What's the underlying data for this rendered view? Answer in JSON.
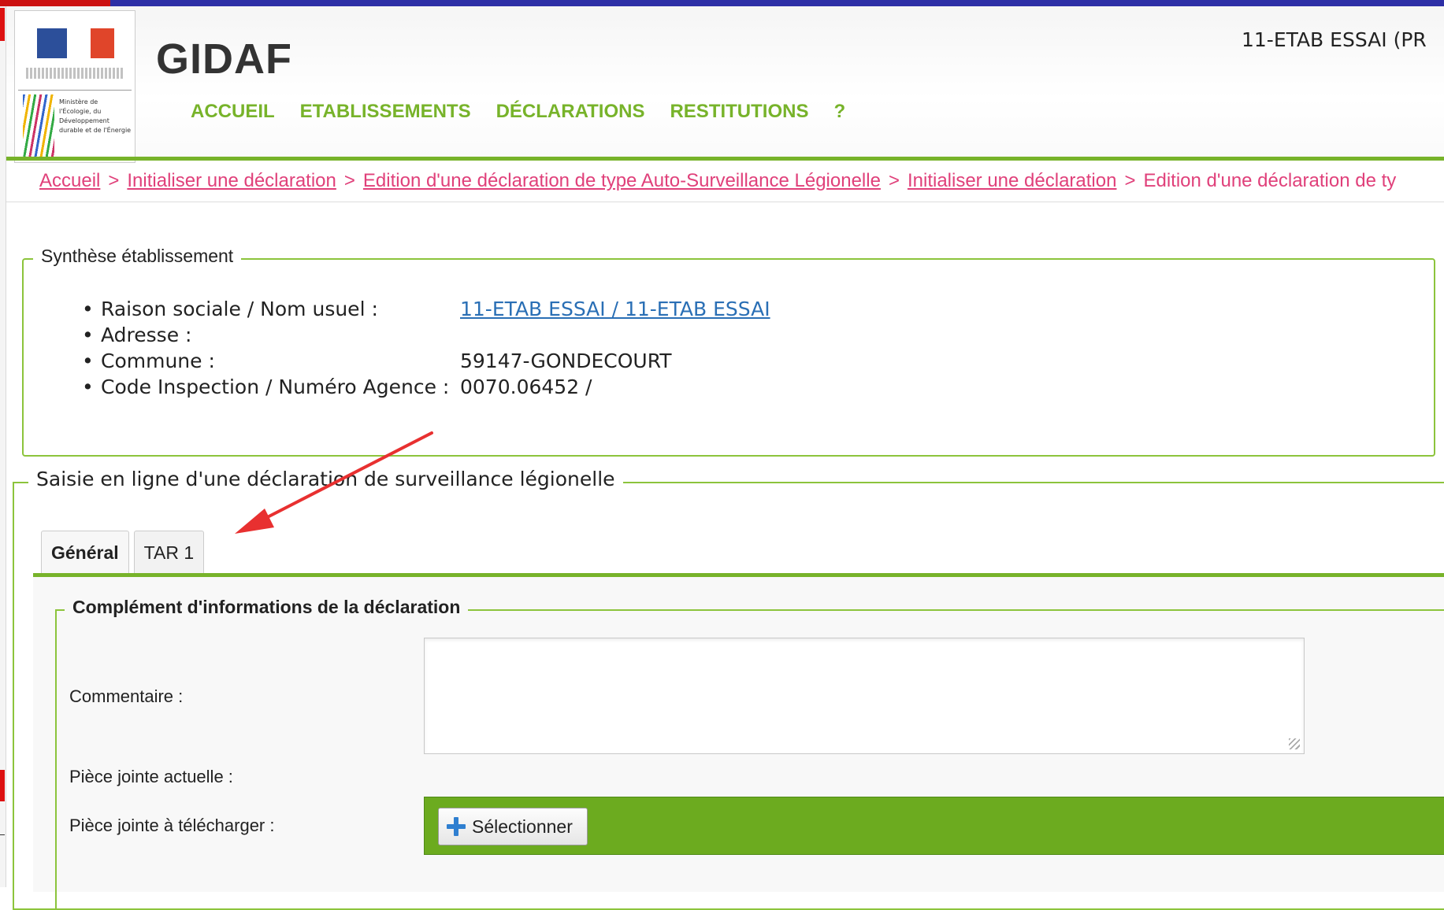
{
  "header": {
    "app_title": "GIDAF",
    "user": "11-ETAB ESSAI (PR",
    "logo_text": "Ministère de l'Écologie, du Développement durable et de l'Énergie",
    "nav": [
      "ACCUEIL",
      "ETABLISSEMENTS",
      "DÉCLARATIONS",
      "RESTITUTIONS",
      "?"
    ]
  },
  "breadcrumb": {
    "items": [
      "Accueil",
      "Initialiser une déclaration",
      "Edition d'une déclaration de type Auto-Surveillance Légionelle",
      "Initialiser une déclaration"
    ],
    "current": "Edition d'une déclaration de ty",
    "separator": ">"
  },
  "synthese": {
    "legend": "Synthèse établissement",
    "rows": [
      {
        "label": "Raison sociale / Nom usuel :",
        "value": "11-ETAB ESSAI / 11-ETAB ESSAI"
      },
      {
        "label": "Adresse :",
        "value": ""
      },
      {
        "label": "Commune :",
        "value": "59147-GONDECOURT"
      },
      {
        "label": "Code Inspection / Numéro Agence :",
        "value": "0070.06452 /"
      }
    ]
  },
  "saisie": {
    "legend": "Saisie en ligne d'une déclaration de surveillance légionelle",
    "tabs": [
      "Général",
      "TAR 1"
    ],
    "complement_legend": "Complément d'informations de la déclaration",
    "comment_label": "Commentaire :",
    "comment_value": "",
    "current_attachment_label": "Pièce jointe actuelle :",
    "upload_label": "Pièce jointe à télécharger :",
    "select_button": "Sélectionner"
  },
  "colors": {
    "nav_green": "#77b32a",
    "breadcrumb_pink": "#e0407a",
    "link_blue": "#2a6fb5",
    "upload_bar_green": "#6cab1f",
    "annotation_arrow": "#e83030"
  }
}
